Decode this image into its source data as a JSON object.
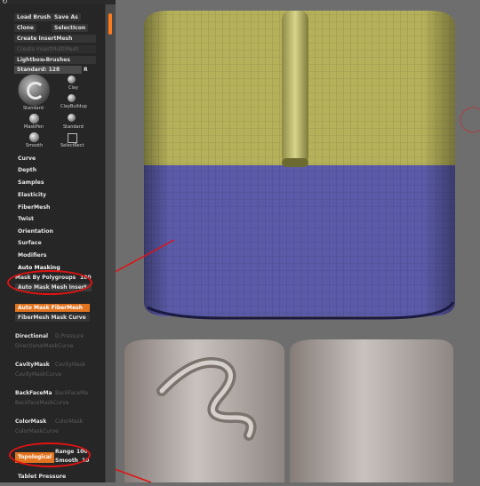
{
  "top_strip": {
    "icon": "refresh-icon"
  },
  "brush": {
    "load_brush": "Load Brush",
    "save_as": "Save As",
    "clone": "Clone",
    "selection": "SelectIcon",
    "create_insert_mesh": "Create InsertMesh",
    "create_insert_multimesh": "Create InsertMultiMesh",
    "lightbox_brushes": "Lightbox▸Brushes",
    "standard_slider_label": "Standard: 128",
    "standard_slider_r": "R",
    "brushes": [
      {
        "label": "Standard"
      },
      {
        "label": "Clay"
      },
      {
        "label": "ClayBuildup"
      },
      {
        "label": "MaskPen"
      },
      {
        "label": "Standard"
      },
      {
        "label": "Smooth"
      },
      {
        "label": "SelectRect"
      }
    ]
  },
  "menu_items": [
    "Curve",
    "Depth",
    "Samples",
    "Elasticity",
    "FiberMesh",
    "Twist",
    "Orientation",
    "Surface",
    "Modifiers"
  ],
  "auto_masking": {
    "title": "Auto Masking",
    "mask_by_polygroups": "Mask By Polygroups",
    "mask_by_polygroups_value": "100",
    "auto_mask_mesh_insert": "Auto Mask Mesh Insert",
    "auto_mask_fibermesh": "Auto Mask FiberMesh",
    "fibermesh_mask_curve": "FiberMesh Mask Curve",
    "directional": "Directional",
    "directional_pressure": "D.Pressure",
    "directional_mask_curve": "DirectionalMaskCurve",
    "cavity_mask": "CavityMask",
    "cavity_mask_value": "CavityMask",
    "cavity_mask_curve": "CavityMaskCurve",
    "backface_mask": "BackFaceMa",
    "backface_mask_value": "BackFaceMa",
    "backface_mask_curve": "BackfaceMaskCurve",
    "color_mask": "ColorMask",
    "color_mask_value": "ColorMask",
    "color_mask_curve": "ColorMaskCurve",
    "topological": "Topological",
    "range_label": "Range",
    "range_value": "100",
    "smooth_label": "Smooth",
    "smooth_value": "10",
    "tablet_pressure": "Tablet Pressure"
  },
  "colors": {
    "accent": "#e3741f",
    "annotation_red": "#e21212",
    "cylinder_top": "#b5b05a",
    "cylinder_bottom": "#5a5aa8",
    "lower_mesh": "#a8a09c"
  }
}
